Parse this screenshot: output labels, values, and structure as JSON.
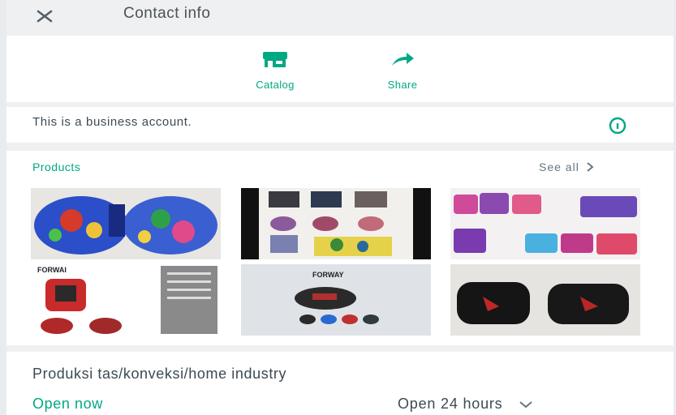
{
  "header": {
    "title": "Contact info",
    "close_icon": "close-icon"
  },
  "actions": [
    {
      "label": "Catalog",
      "icon": "storefront-icon"
    },
    {
      "label": "Share",
      "icon": "share-arrow-icon"
    }
  ],
  "business": {
    "text": "This is a business account.",
    "icon": "info-icon"
  },
  "products": {
    "title": "Products",
    "see_all": "See all",
    "items": [
      {
        "image": "blue-backpacks-photo"
      },
      {
        "image": "handbags-collage-photo"
      },
      {
        "image": "pink-purple-pouches-photo"
      },
      {
        "image": "red-backpack-catalog-photo",
        "caption": "FORWAI"
      },
      {
        "image": "waist-bag-catalog-photo",
        "caption": "FORWAY"
      },
      {
        "image": "black-duffel-bags-photo"
      }
    ]
  },
  "description": "Produksi tas/konveksi/home industry",
  "hours": {
    "status": "Open now",
    "schedule": "Open 24 hours"
  },
  "colors": {
    "accent": "#00a884",
    "text": "#3b4a54",
    "muted": "#667781",
    "divider": "#eef0f1"
  }
}
